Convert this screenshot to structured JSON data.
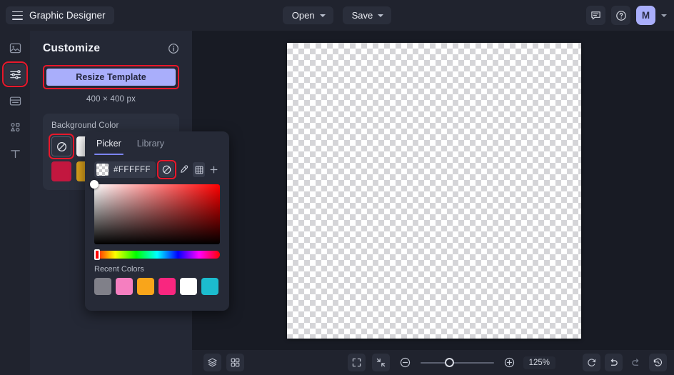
{
  "app": {
    "title": "Graphic Designer",
    "menu_icon": "hamburger-menu-icon"
  },
  "topbar": {
    "open_label": "Open",
    "save_label": "Save",
    "comment_icon": "comment-icon",
    "help_icon": "help-circle-icon",
    "avatar_initial": "M",
    "avatar_color": "#a9aefb"
  },
  "rail": {
    "items": [
      {
        "name": "image-icon"
      },
      {
        "name": "sliders-icon",
        "highlighted": true
      },
      {
        "name": "layout-icon"
      },
      {
        "name": "shapes-icon"
      },
      {
        "name": "text-icon"
      }
    ]
  },
  "panel": {
    "title": "Customize",
    "info_icon": "info-circle-icon",
    "resize_button_label": "Resize Template",
    "resize_button_color": "#a9aefb",
    "dimensions": "400 × 400 px",
    "background_color": {
      "label": "Background Color",
      "swatches": [
        {
          "name": "no-color-swatch",
          "color": "none",
          "highlighted": true
        },
        {
          "name": "white-swatch",
          "color": "#ffffff"
        },
        {
          "name": "crimson-swatch",
          "color": "#c2173f"
        },
        {
          "name": "gold-swatch",
          "color": "#dba21c"
        }
      ]
    }
  },
  "picker": {
    "tabs": [
      {
        "label": "Picker",
        "active": true
      },
      {
        "label": "Library",
        "active": false
      }
    ],
    "hex_value": "#FFFFFF",
    "no_color_icon": "no-color-icon",
    "eyedropper_icon": "eyedropper-icon",
    "palette_grid_icon": "palette-grid-icon",
    "add_icon": "plus-icon",
    "hue": "#ff0000",
    "recent_colors_label": "Recent Colors",
    "recent_colors": [
      {
        "name": "recent-gray",
        "color": "#808089"
      },
      {
        "name": "recent-pink",
        "color": "#f57fc0"
      },
      {
        "name": "recent-orange",
        "color": "#f9a51a"
      },
      {
        "name": "recent-magenta",
        "color": "#f9267f"
      },
      {
        "name": "recent-white",
        "color": "#ffffff"
      },
      {
        "name": "recent-cyan",
        "color": "#1cbcce"
      }
    ]
  },
  "canvas": {
    "name": "design-canvas",
    "transparent": true
  },
  "bottombar": {
    "layers_icon": "layers-icon",
    "grid_icon": "grid-view-icon",
    "fit_icon": "fit-to-screen-icon",
    "shrink_icon": "shrink-icon",
    "zoom_out_icon": "zoom-out-icon",
    "zoom_in_icon": "zoom-in-icon",
    "zoom_level": "125%",
    "refresh_icon": "refresh-icon",
    "undo_icon": "undo-icon",
    "redo_icon": "redo-icon",
    "history_icon": "history-icon"
  },
  "highlight_color": "#e8182b"
}
